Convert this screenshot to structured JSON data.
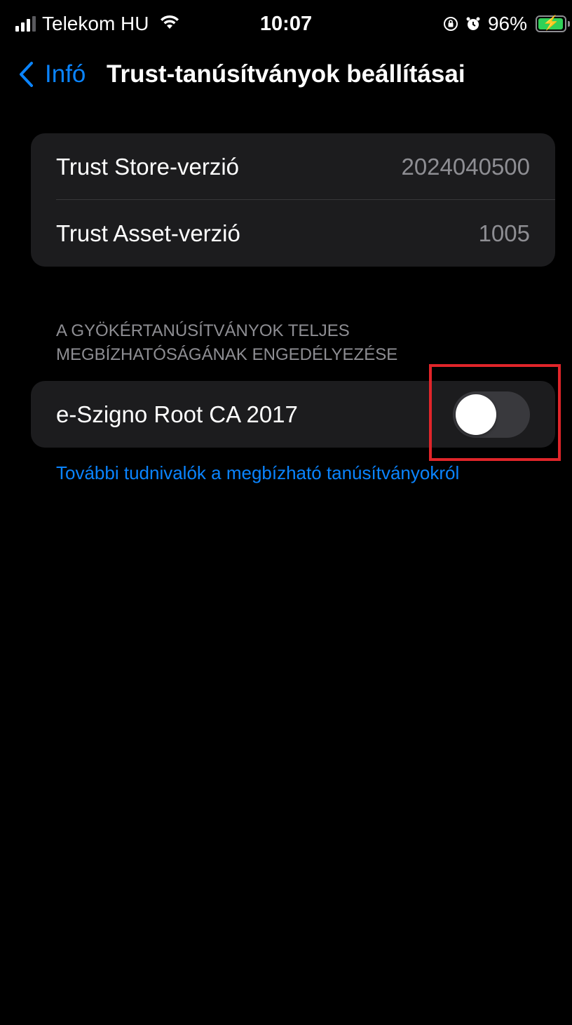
{
  "status_bar": {
    "carrier": "Telekom HU",
    "time": "10:07",
    "battery_percent": "96%",
    "battery_level": 0.96,
    "icons": [
      "signal-icon",
      "wifi-icon",
      "orientation-lock-icon",
      "alarm-icon",
      "battery-charging-icon"
    ]
  },
  "nav": {
    "back_label": "Infó",
    "title": "Trust-tanúsítványok beállításai"
  },
  "versions": [
    {
      "label": "Trust Store-verzió",
      "value": "2024040500"
    },
    {
      "label": "Trust Asset-verzió",
      "value": "1005"
    }
  ],
  "root_section": {
    "header_line1": "A GYÖKÉRTANÚSÍTVÁNYOK TELJES",
    "header_line2": "MEGBÍZHATÓSÁGÁNAK ENGEDÉLYEZÉSE",
    "certificate": {
      "label": "e-Szigno Root CA 2017",
      "enabled": false
    }
  },
  "learn_more_link": "További tudnivalók a megbízható tanúsítványokról",
  "colors": {
    "background": "#000000",
    "card": "#1c1c1e",
    "accent": "#0a84ff",
    "secondary_text": "#8e8e93",
    "toggle_off": "#39393d",
    "highlight": "#e0252a"
  }
}
